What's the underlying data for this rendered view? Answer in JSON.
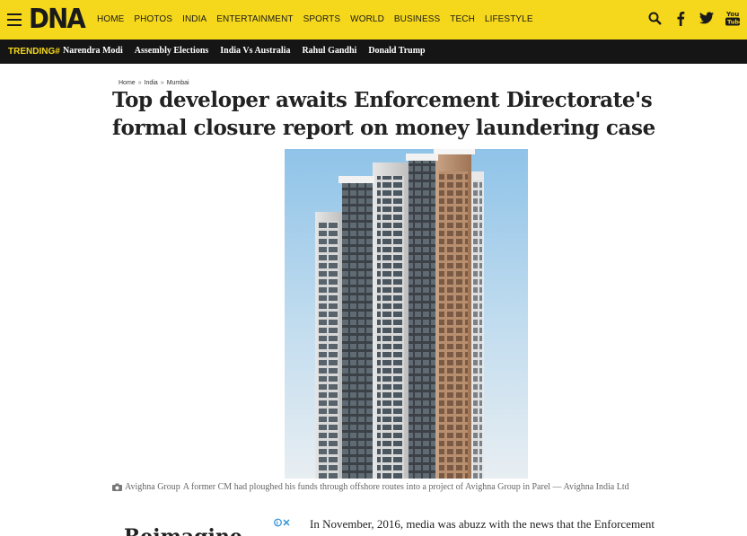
{
  "header": {
    "logo": "DNA",
    "nav": [
      "HOME",
      "PHOTOS",
      "INDIA",
      "ENTERTAINMENT",
      "SPORTS",
      "WORLD",
      "BUSINESS",
      "TECH",
      "LIFESTYLE"
    ],
    "social": [
      "search-icon",
      "facebook-icon",
      "twitter-icon",
      "youtube-icon"
    ],
    "accent_color": "#f5d81c"
  },
  "trending": {
    "label": "TRENDING#",
    "items": [
      "Narendra Modi",
      "Assembly Elections",
      "India Vs Australia",
      "Rahul Gandhi",
      "Donald Trump"
    ]
  },
  "breadcrumb": [
    "Home",
    "India",
    "Mumbai"
  ],
  "article": {
    "title": "Top developer awaits Enforcement Directorate's formal closure report on money laundering case",
    "caption_credit": "Avighna Group",
    "caption_text": "A former CM had ploughed his funds through offshore routes into a project of Avighna Group in Parel — Avighna India Ltd",
    "body_start": "In November, 2016, media was abuzz with the news that the Enforcement"
  },
  "ad": {
    "heading_fragment": "Reimagine"
  }
}
